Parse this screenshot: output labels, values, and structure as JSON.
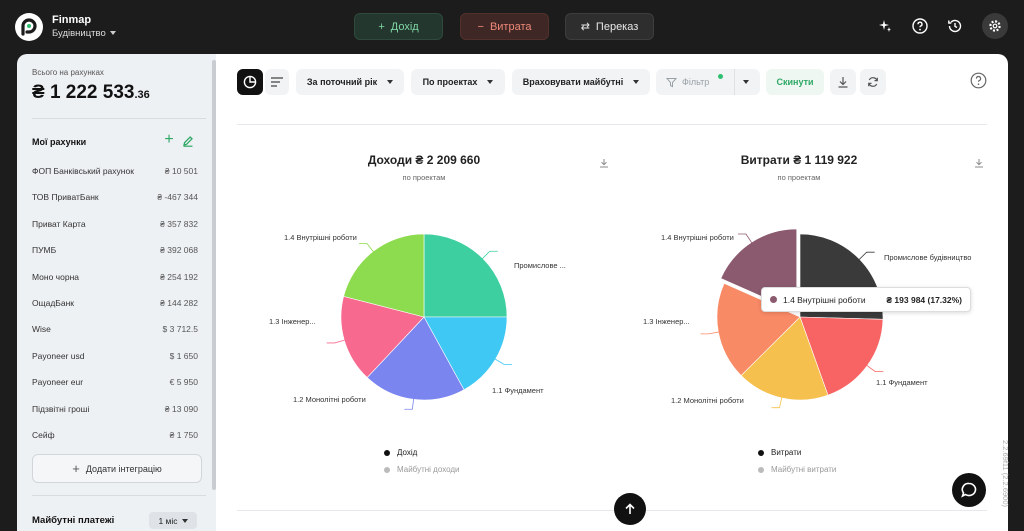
{
  "app": {
    "name": "Finmap",
    "workspace": "Будівництво",
    "version": "2.2.69f11 (2.2.6900)"
  },
  "toolbar": {
    "income": "Дохід",
    "expense": "Витрата",
    "transfer": "Переказ"
  },
  "sidebar": {
    "total_label": "Всього на рахунках",
    "total_main": "₴ 1 222 533",
    "total_cents": ".36",
    "accounts_title": "Мої рахунки",
    "accounts": [
      {
        "name": "ФОП Банківський рахунок",
        "amount": "₴ 10 501"
      },
      {
        "name": "ТОВ ПриватБанк",
        "amount": "₴ -467 344"
      },
      {
        "name": "Приват Карта",
        "amount": "₴ 357 832"
      },
      {
        "name": "ПУМБ",
        "amount": "₴ 392 068"
      },
      {
        "name": "Моно чорна",
        "amount": "₴ 254 192"
      },
      {
        "name": "ОщадБанк",
        "amount": "₴ 144 282"
      },
      {
        "name": "Wise",
        "amount": "$ 3 712.5"
      },
      {
        "name": "Payoneer usd",
        "amount": "$ 1 650"
      },
      {
        "name": "Payoneer eur",
        "amount": "€ 5 950"
      },
      {
        "name": "Підзвітні гроші",
        "amount": "₴ 13 090"
      },
      {
        "name": "Сейф",
        "amount": "₴ 1 750"
      }
    ],
    "integration_button": "Додати інтеграцію",
    "future_title": "Майбутні платежі",
    "future_period": "1 міс"
  },
  "filters": {
    "period": "За поточний рік",
    "group": "По проектах",
    "future": "Враховувати майбутні",
    "filter": "Фільтр",
    "reset": "Скинути"
  },
  "colors": {
    "income_accent": "#7fd6a6",
    "expense_accent": "#f08a79",
    "brand_green": "#2fa866"
  },
  "chart_data": [
    {
      "type": "pie",
      "title": "Доходи ₴ 2 209 660",
      "subtitle": "по проектам",
      "legend": [
        "Дохід",
        "Майбутні доходи"
      ],
      "slices": [
        {
          "label": "Промислове ...",
          "value": 0.25,
          "color": "#3ecfa0"
        },
        {
          "label": "1.1 Фундамент",
          "value": 0.17,
          "color": "#3fc8f4"
        },
        {
          "label": "1.2 Монолітні роботи",
          "value": 0.2,
          "color": "#7b85ef"
        },
        {
          "label": "1.3 Інженер...",
          "value": 0.17,
          "color": "#f7698e"
        },
        {
          "label": "1.4 Внутрішні роботи",
          "value": 0.21,
          "color": "#8ddb4e"
        }
      ]
    },
    {
      "type": "pie",
      "title": "Витрати ₴ 1 119 922",
      "subtitle": "по проектам",
      "legend": [
        "Витрати",
        "Майбутні витрати"
      ],
      "slices": [
        {
          "label": "Промислове будівництво",
          "value": 0.24,
          "color": "#3a3a3a"
        },
        {
          "label": "1.1 Фундамент",
          "value": 0.18,
          "color": "#f86464"
        },
        {
          "label": "1.2 Монолітні роботи",
          "value": 0.17,
          "color": "#f6c04e"
        },
        {
          "label": "1.3 Інженер...",
          "value": 0.18,
          "color": "#f98a66"
        },
        {
          "label": "1.4 Внутрішні роботи",
          "value": 0.1732,
          "color": "#8b5a6e"
        }
      ],
      "tooltip": {
        "label": "1.4 Внутрішні роботи",
        "value": "₴ 193 984 (17.32%)"
      }
    }
  ]
}
